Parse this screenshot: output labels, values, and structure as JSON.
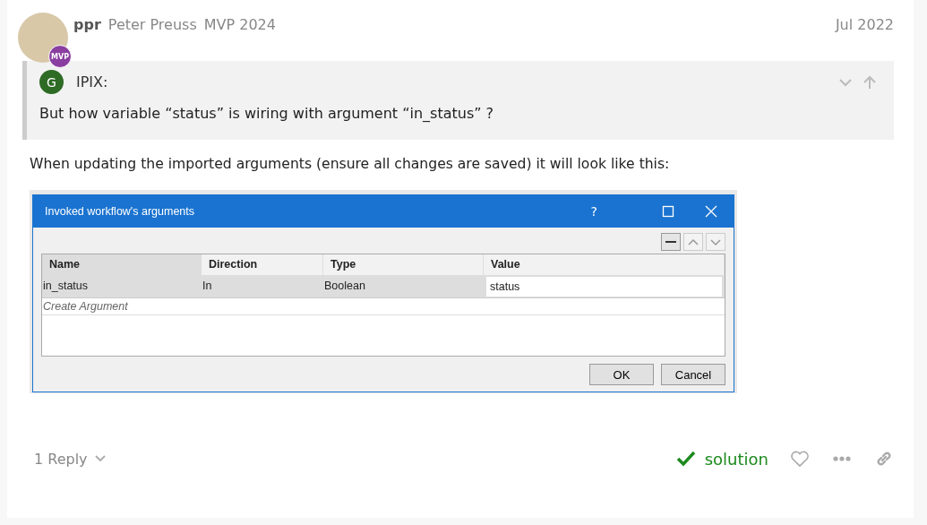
{
  "post": {
    "username": "ppr",
    "full_name": "Peter Preuss",
    "title": "MVP 2024",
    "date": "Jul 2022",
    "avatar_badge": "MVP"
  },
  "quote": {
    "avatar_letter": "G",
    "author": "IPIX:",
    "text": "But how variable “status” is wiring with argument “in_status” ?"
  },
  "body": "When updating the imported arguments (ensure all changes are saved) it will look like this:",
  "dialog": {
    "title": "Invoked workflow's arguments",
    "title_buttons": [
      "?"
    ],
    "columns": [
      "Name",
      "Direction",
      "Type",
      "Value"
    ],
    "rows": [
      {
        "cells": [
          "in_status",
          "In",
          "Boolean",
          "status"
        ]
      }
    ],
    "create_placeholder": "Create Argument",
    "buttons": [
      "OK",
      "Cancel"
    ]
  },
  "footer": {
    "replies": "1 Reply",
    "solution": "solution"
  }
}
